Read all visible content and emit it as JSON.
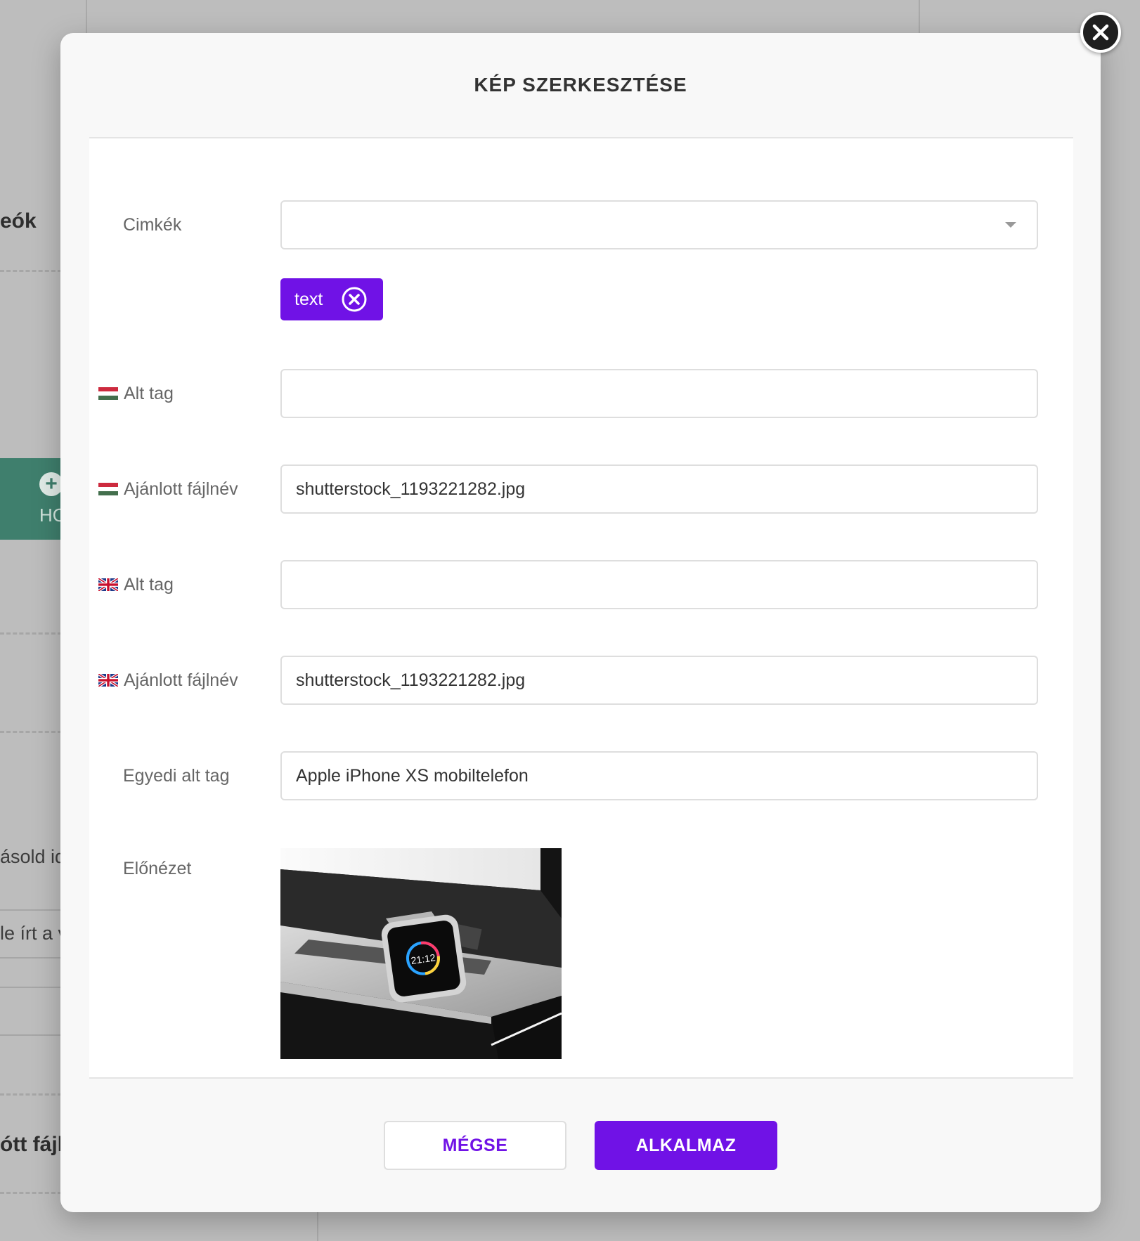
{
  "background": {
    "fragments": [
      "eók",
      "HO",
      "ásold id",
      "le írt a v",
      "ótt fájl"
    ]
  },
  "modal": {
    "title": "KÉP SZERKESZTÉSE",
    "close_icon": "close-icon",
    "fields": {
      "tags": {
        "label": "Cimkék",
        "value": "",
        "chips": [
          {
            "label": "text"
          }
        ]
      },
      "hu_alt": {
        "label": "Alt tag",
        "value": "",
        "flag": "hu-flag-icon"
      },
      "hu_filename": {
        "label": "Ajánlott fájlnév",
        "value": "shutterstock_1193221282.jpg",
        "flag": "hu-flag-icon"
      },
      "en_alt": {
        "label": "Alt tag",
        "value": "",
        "flag": "uk-flag-icon"
      },
      "en_filename": {
        "label": "Ajánlott fájlnév",
        "value": "shutterstock_1193221282.jpg",
        "flag": "uk-flag-icon"
      },
      "custom_alt": {
        "label": "Egyedi alt tag",
        "value": "Apple iPhone XS mobiltelefon"
      }
    },
    "preview": {
      "label": "Előnézet",
      "watch_time": "21:12"
    },
    "buttons": {
      "cancel": "MÉGSE",
      "apply": "ALKALMAZ"
    }
  },
  "colors": {
    "accent": "#7012e6",
    "overlay": "#bdbdbd",
    "modal_bg": "#f8f8f8",
    "close_button": "#1f1f1f",
    "background_green": "#3f7f6d"
  }
}
